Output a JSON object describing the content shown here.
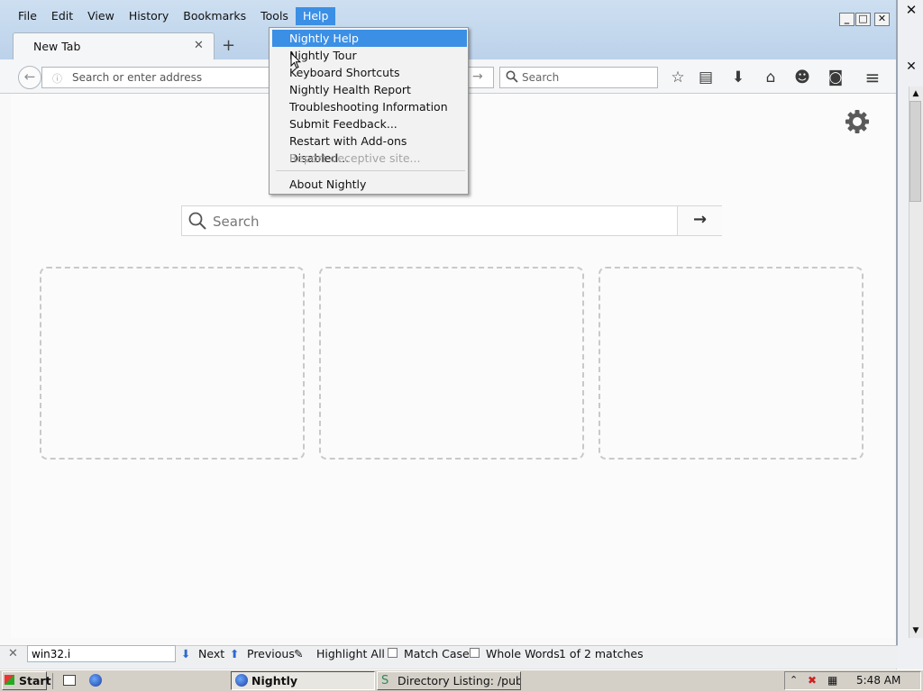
{
  "app": {
    "browser_name": "Nightly"
  },
  "menubar": {
    "items": [
      "File",
      "Edit",
      "View",
      "History",
      "Bookmarks",
      "Tools",
      "Help"
    ],
    "active": "Help"
  },
  "tab": {
    "title": "New Tab"
  },
  "navbar": {
    "url_placeholder": "Search or enter address",
    "search_placeholder": "Search",
    "toolbar_icons": [
      "bookmark-star-icon",
      "reading-list-icon",
      "downloads-icon",
      "home-icon",
      "hello-icon",
      "pocket-icon",
      "hamburger-menu-icon"
    ]
  },
  "help_menu": {
    "items": [
      {
        "label": "Nightly Help",
        "highlighted": true,
        "disabled": false
      },
      {
        "label": "Nightly Tour",
        "highlighted": false,
        "disabled": false
      },
      {
        "label": "Keyboard Shortcuts",
        "highlighted": false,
        "disabled": false
      },
      {
        "label": "Nightly Health Report",
        "highlighted": false,
        "disabled": false
      },
      {
        "label": "Troubleshooting Information",
        "highlighted": false,
        "disabled": false
      },
      {
        "label": "Submit Feedback...",
        "highlighted": false,
        "disabled": false
      },
      {
        "label": "Restart with Add-ons Disabled...",
        "highlighted": false,
        "disabled": false
      },
      {
        "label": "Report deceptive site...",
        "highlighted": false,
        "disabled": true
      },
      {
        "label": "About Nightly",
        "highlighted": false,
        "disabled": false
      }
    ]
  },
  "newtab": {
    "search_placeholder": "Search",
    "tile_count": 3
  },
  "findbar": {
    "query": "win32.i",
    "next_label": "Next",
    "previous_label": "Previous",
    "highlight_all_label": "Highlight All",
    "match_case_label": "Match Case",
    "whole_words_label": "Whole Words",
    "status": "1 of 2 matches"
  },
  "taskbar": {
    "start_label": "Start",
    "tasks": [
      "Nightly",
      "Directory Listing: /pub/..."
    ],
    "clock": "5:48 AM"
  },
  "colors": {
    "menu_highlight": "#3b8fe5",
    "titlebar": "#c6d9ee"
  }
}
